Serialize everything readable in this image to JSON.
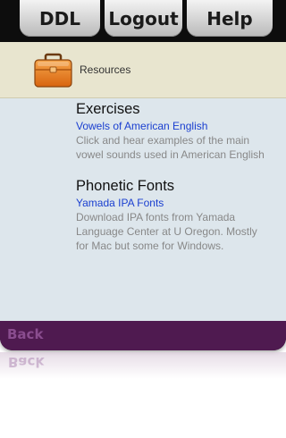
{
  "tabs": {
    "ddl": "DDL",
    "logout": "Logout",
    "help": "Help"
  },
  "section": {
    "icon": "briefcase-icon",
    "label": "Resources"
  },
  "groups": [
    {
      "title": "Exercises",
      "link": "Vowels of American English",
      "description": "Click and hear examples of the main\nvowel sounds used in American English"
    },
    {
      "title": "Phonetic Fonts",
      "link": "Yamada IPA Fonts",
      "description": "Download IPA fonts from Yamada\nLanguage Center at U Oregon. Mostly\nfor Mac but some for Windows."
    }
  ],
  "bottom": {
    "back_label": "Back"
  },
  "colors": {
    "header_bg": "#e8e5cf",
    "content_bg": "#dde6ec",
    "link": "#1a3fd0",
    "bottom_bar": "#4f1a50",
    "briefcase": "#e07a1a"
  }
}
